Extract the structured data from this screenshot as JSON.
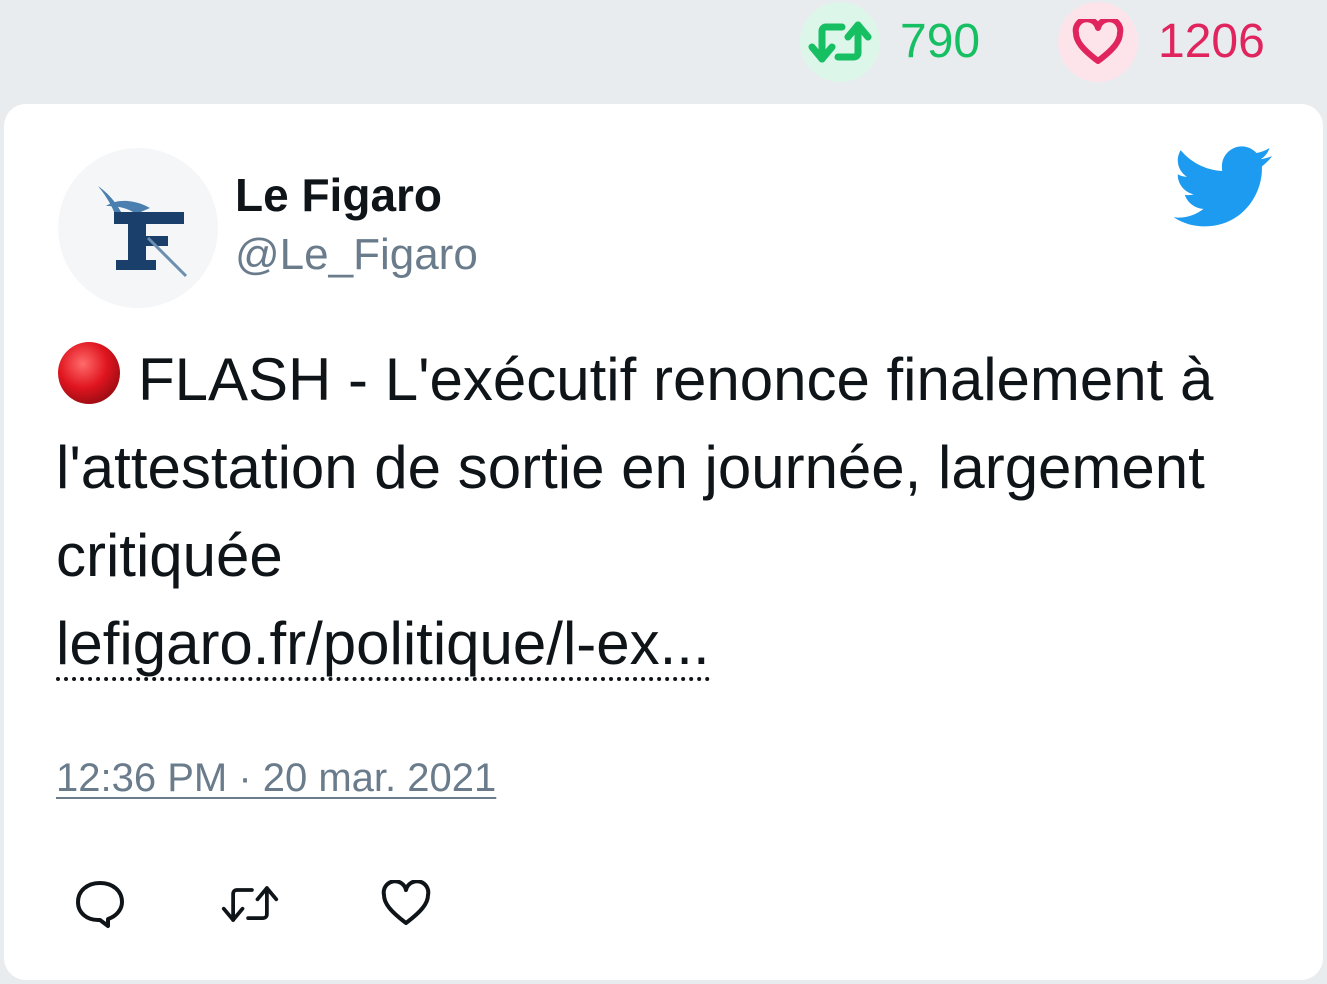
{
  "stats": {
    "retweets": "790",
    "likes": "1206"
  },
  "author": {
    "name": "Le Figaro",
    "handle": "@Le_Figaro",
    "avatar_icon": "le-figaro-logo"
  },
  "tweet": {
    "emoji": "red-circle",
    "text": "FLASH - L'exécutif renonce finalement à l'attestation de sortie en journée, largement critiquée",
    "link": "lefigaro.fr/politique/l-ex...",
    "timestamp": "12:36 PM · 20 mar. 2021"
  },
  "actions": {
    "reply_icon": "reply-icon",
    "retweet_icon": "retweet-icon",
    "like_icon": "heart-icon"
  },
  "colors": {
    "retweet": "#17bf63",
    "like": "#e0245e",
    "twitter_blue": "#1d9bf0",
    "muted": "#6a7c8c"
  }
}
